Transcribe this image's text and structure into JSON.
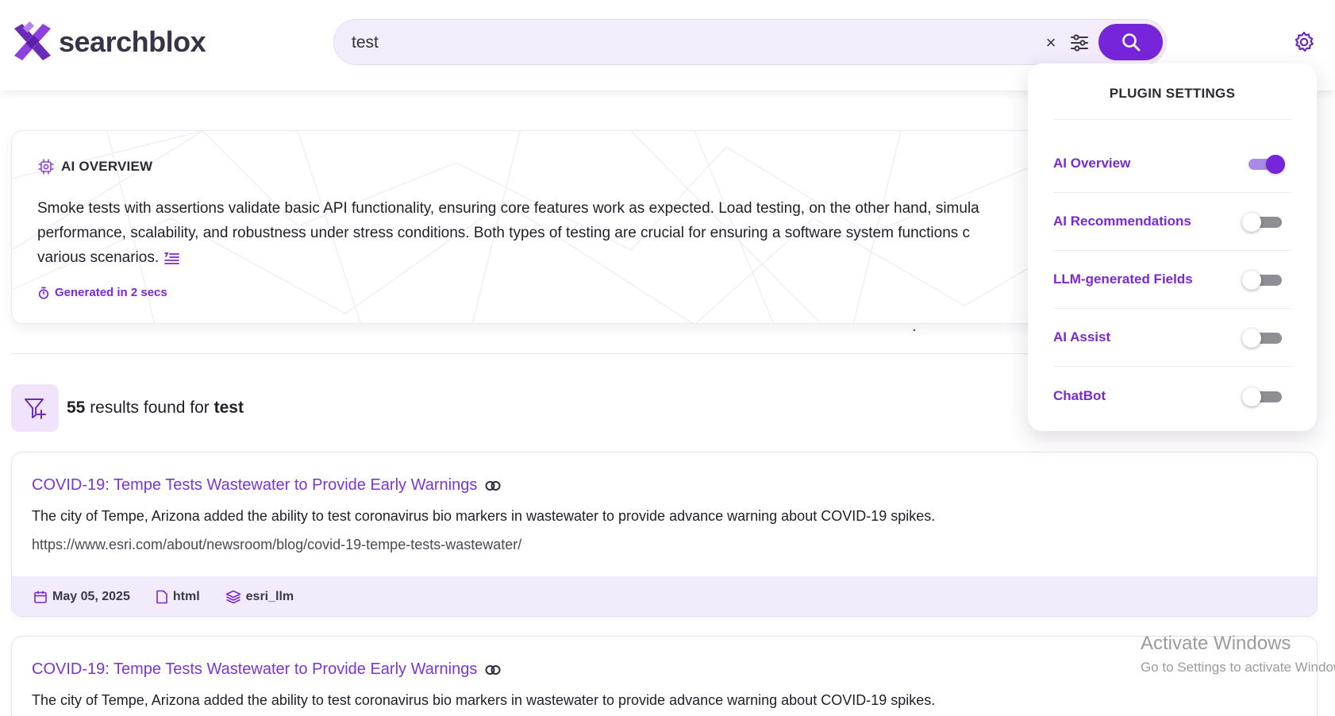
{
  "brand": {
    "name": "searchblox"
  },
  "search": {
    "query": "test"
  },
  "colors": {
    "accent": "#7625d9",
    "accent_light": "#efe4fb",
    "link": "#7a36d3",
    "meta_bg": "#f1ebfb"
  },
  "ai_overview": {
    "title": "AI OVERVIEW",
    "lines": [
      "Smoke tests with assertions validate basic API functionality, ensuring core features work as expected. Load testing, on the other hand, simula",
      "performance, scalability, and robustness under stress conditions. Both types of testing are crucial for ensuring a software system functions c",
      "various scenarios."
    ],
    "generated": "Generated in 2 secs"
  },
  "results": {
    "count": "55",
    "middle": " results found for ",
    "query": "test",
    "items": [
      {
        "title": "COVID-19: Tempe Tests Wastewater to Provide Early Warnings",
        "description": "The city of Tempe, Arizona added the ability to test coronavirus bio markers in wastewater to provide advance warning about COVID-19 spikes.",
        "url": "https://www.esri.com/about/newsroom/blog/covid-19-tempe-tests-wastewater/",
        "date": "May 05, 2025",
        "type": "html",
        "collection": "esri_llm"
      },
      {
        "title": "COVID-19: Tempe Tests Wastewater to Provide Early Warnings",
        "description": "The city of Tempe, Arizona added the ability to test coronavirus bio markers in wastewater to provide advance warning about COVID-19 spikes."
      }
    ]
  },
  "plugin_settings": {
    "title": "PLUGIN SETTINGS",
    "items": [
      {
        "label": "AI Overview",
        "enabled": true
      },
      {
        "label": "AI Recommendations",
        "enabled": false
      },
      {
        "label": "LLM-generated Fields",
        "enabled": false
      },
      {
        "label": "AI Assist",
        "enabled": false
      },
      {
        "label": "ChatBot",
        "enabled": false
      }
    ]
  },
  "watermark": {
    "title": "Activate Windows",
    "subtitle": "Go to Settings to activate Windows."
  }
}
